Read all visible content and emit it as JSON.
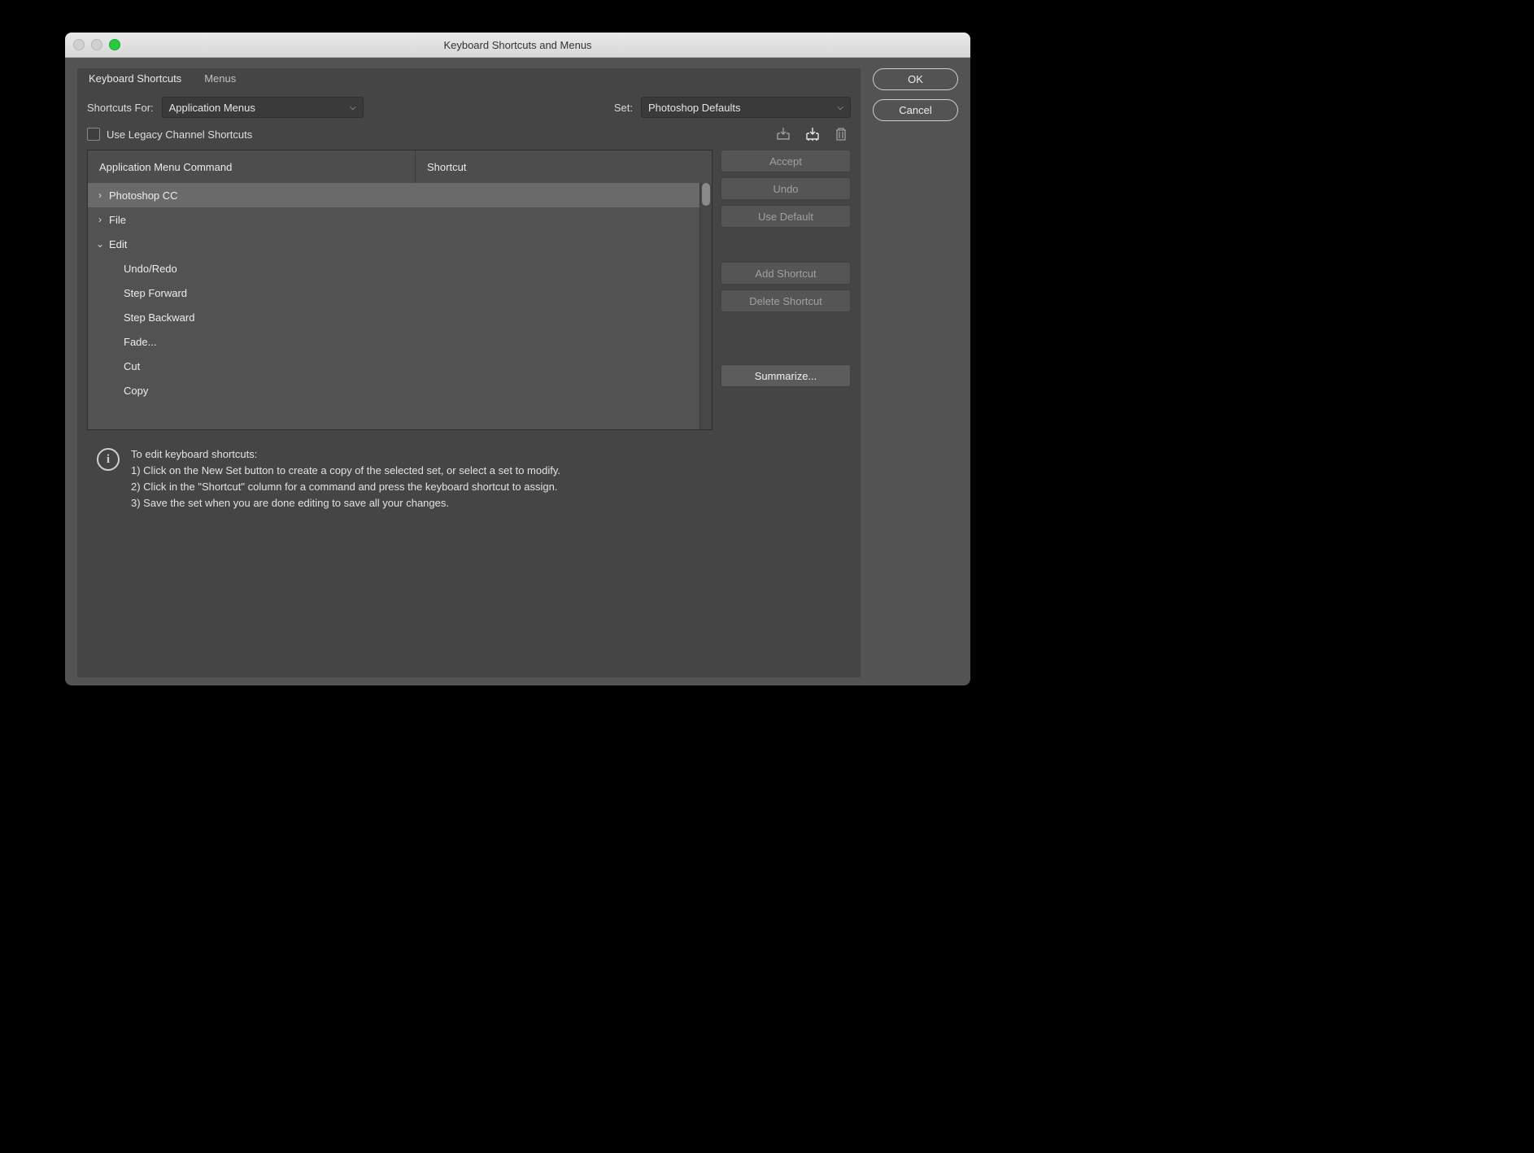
{
  "window": {
    "title": "Keyboard Shortcuts and Menus"
  },
  "tabs": [
    {
      "label": "Keyboard Shortcuts",
      "active": true
    },
    {
      "label": "Menus",
      "active": false
    }
  ],
  "shortcuts_for_label": "Shortcuts For:",
  "shortcuts_for_value": "Application Menus",
  "set_label": "Set:",
  "set_value": "Photoshop Defaults",
  "legacy_checkbox_label": "Use Legacy Channel Shortcuts",
  "table": {
    "header_command": "Application Menu Command",
    "header_shortcut": "Shortcut",
    "rows": [
      {
        "label": "Photoshop CC",
        "arrow": "right",
        "selected": true,
        "child": false
      },
      {
        "label": "File",
        "arrow": "right",
        "selected": false,
        "child": false
      },
      {
        "label": "Edit",
        "arrow": "down",
        "selected": false,
        "child": false
      },
      {
        "label": "Undo/Redo",
        "arrow": "",
        "selected": false,
        "child": true
      },
      {
        "label": "Step Forward",
        "arrow": "",
        "selected": false,
        "child": true
      },
      {
        "label": "Step Backward",
        "arrow": "",
        "selected": false,
        "child": true
      },
      {
        "label": "Fade...",
        "arrow": "",
        "selected": false,
        "child": true
      },
      {
        "label": "Cut",
        "arrow": "",
        "selected": false,
        "child": true
      },
      {
        "label": "Copy",
        "arrow": "",
        "selected": false,
        "child": true
      }
    ]
  },
  "action_buttons": {
    "accept": "Accept",
    "undo": "Undo",
    "use_default": "Use Default",
    "add_shortcut": "Add Shortcut",
    "delete_shortcut": "Delete Shortcut",
    "summarize": "Summarize..."
  },
  "info": {
    "heading": "To edit keyboard shortcuts:",
    "line1": "1) Click on the New Set button to create a copy of the selected set, or select a set to modify.",
    "line2": "2) Click in the \"Shortcut\" column for a command and press the keyboard shortcut to assign.",
    "line3": "3) Save the set when you are done editing to save all your changes."
  },
  "dialog_buttons": {
    "ok": "OK",
    "cancel": "Cancel"
  },
  "toolbar_icons": {
    "save": "save-set-icon",
    "new_set": "new-set-icon",
    "delete": "trash-icon"
  }
}
